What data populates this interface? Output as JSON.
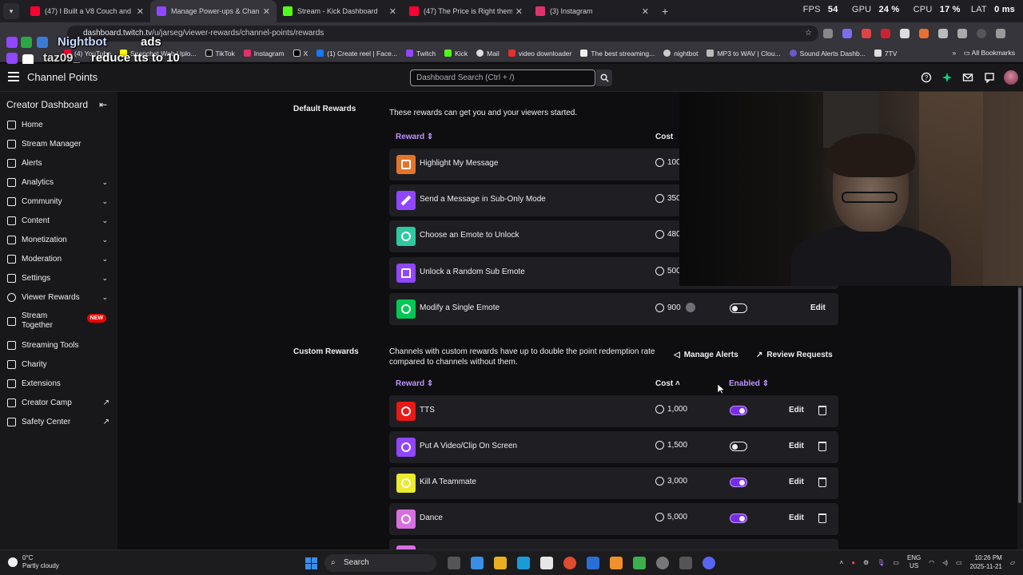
{
  "browser": {
    "tabs": [
      {
        "title": "(47) I Built a V8 Couch and Ro...",
        "color": "#ff0033"
      },
      {
        "title": "Manage Power-ups & Channel...",
        "color": "#9146ff"
      },
      {
        "title": "Stream - Kick Dashboard",
        "color": "#53fc18"
      },
      {
        "title": "(47) The Price is Right theme so...",
        "color": "#ff0033"
      },
      {
        "title": "(3) Instagram",
        "color": "#e1306c"
      }
    ],
    "perf": {
      "fps_label": "FPS",
      "fps": "54",
      "gpu_label": "GPU",
      "gpu": "24 %",
      "cpu_label": "CPU",
      "cpu": "17 %",
      "lat_label": "LAT",
      "lat": "0 ms"
    },
    "url_host": "dashboard.twitch.tv",
    "url_path": "/u/jarseg/viewer-rewards/channel-points/rewards",
    "bookmarks": [
      "(4) YouTube",
      "Snapchat Web Uplo...",
      "TikTok",
      "Instagram",
      "X",
      "(1) Create reel | Face...",
      "Twitch",
      "Kick",
      "Mail",
      "video downloader",
      "The best streaming...",
      "nightbot",
      "MP3 to WAV | Clou...",
      "Sound Alerts Dashb...",
      "7TV"
    ],
    "all_bookmarks": "All Bookmarks"
  },
  "overlay": {
    "bot_name": "Nightbot",
    "bot_msg": "ads",
    "user": "taz09_",
    "user_msg": "reduce tts to 10"
  },
  "topnav": {
    "title": "Channel Points",
    "search_placeholder": "Dashboard Search (Ctrl + /)"
  },
  "sidebar": {
    "heading": "Creator Dashboard",
    "items": [
      {
        "label": "Home"
      },
      {
        "label": "Stream Manager"
      },
      {
        "label": "Alerts"
      },
      {
        "label": "Analytics"
      },
      {
        "label": "Community"
      },
      {
        "label": "Content"
      },
      {
        "label": "Monetization"
      },
      {
        "label": "Moderation"
      },
      {
        "label": "Settings"
      },
      {
        "label": "Viewer Rewards"
      },
      {
        "label": "Stream Together"
      },
      {
        "label": "Streaming Tools"
      },
      {
        "label": "Charity"
      },
      {
        "label": "Extensions"
      },
      {
        "label": "Creator Camp"
      },
      {
        "label": "Safety Center"
      }
    ],
    "new_badge": "NEW"
  },
  "default_rewards": {
    "title": "Default Rewards",
    "description": "These rewards can get you and your viewers started.",
    "col_reward": "Reward",
    "col_cost": "Cost",
    "rows": [
      {
        "name": "Highlight My Message",
        "cost": "100",
        "color": "#e5742b"
      },
      {
        "name": "Send a Message in Sub-Only Mode",
        "cost": "350",
        "color": "#9146ff"
      },
      {
        "name": "Choose an Emote to Unlock",
        "cost": "480",
        "color": "#2ec9a0"
      },
      {
        "name": "Unlock a Random Sub Emote",
        "cost": "500",
        "color": "#9146ff"
      },
      {
        "name": "Modify a Single Emote",
        "cost": "900",
        "color": "#00c853",
        "enabled": false,
        "edit": "Edit"
      }
    ]
  },
  "custom_rewards": {
    "title": "Custom Rewards",
    "description": "Channels with custom rewards have up to double the point redemption rate compared to channels without them.",
    "manage_alerts": "Manage Alerts",
    "review_requests": "Review Requests",
    "col_reward": "Reward",
    "col_cost": "Cost",
    "col_enabled": "Enabled",
    "rows": [
      {
        "name": "TTS",
        "cost": "1,000",
        "enabled": true,
        "color": "#e91916",
        "edit": "Edit"
      },
      {
        "name": "Put A Video/Clip On Screen",
        "cost": "1,500",
        "enabled": false,
        "color": "#9146ff",
        "edit": "Edit"
      },
      {
        "name": "Kill A Teammate",
        "cost": "3,000",
        "enabled": true,
        "color": "#ebeb2f",
        "edit": "Edit"
      },
      {
        "name": "Dance",
        "cost": "5,000",
        "enabled": true,
        "color": "#d86fe0",
        "edit": "Edit"
      }
    ]
  },
  "taskbar": {
    "temp": "0°C",
    "weather": "Partly cloudy",
    "search": "Search",
    "lang1": "ENG",
    "lang2": "US",
    "time": "10:26 PM",
    "date": "2025-11-21"
  }
}
